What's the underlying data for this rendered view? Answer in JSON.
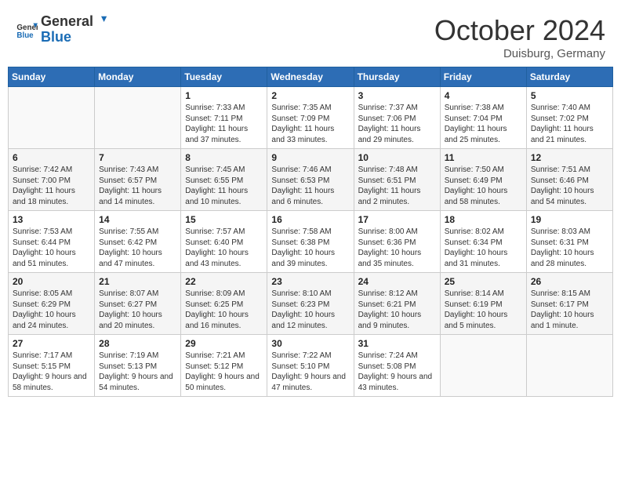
{
  "header": {
    "logo_general": "General",
    "logo_blue": "Blue",
    "month_title": "October 2024",
    "location": "Duisburg, Germany"
  },
  "days_of_week": [
    "Sunday",
    "Monday",
    "Tuesday",
    "Wednesday",
    "Thursday",
    "Friday",
    "Saturday"
  ],
  "weeks": [
    [
      {
        "day": "",
        "info": ""
      },
      {
        "day": "",
        "info": ""
      },
      {
        "day": "1",
        "info": "Sunrise: 7:33 AM\nSunset: 7:11 PM\nDaylight: 11 hours and 37 minutes."
      },
      {
        "day": "2",
        "info": "Sunrise: 7:35 AM\nSunset: 7:09 PM\nDaylight: 11 hours and 33 minutes."
      },
      {
        "day": "3",
        "info": "Sunrise: 7:37 AM\nSunset: 7:06 PM\nDaylight: 11 hours and 29 minutes."
      },
      {
        "day": "4",
        "info": "Sunrise: 7:38 AM\nSunset: 7:04 PM\nDaylight: 11 hours and 25 minutes."
      },
      {
        "day": "5",
        "info": "Sunrise: 7:40 AM\nSunset: 7:02 PM\nDaylight: 11 hours and 21 minutes."
      }
    ],
    [
      {
        "day": "6",
        "info": "Sunrise: 7:42 AM\nSunset: 7:00 PM\nDaylight: 11 hours and 18 minutes."
      },
      {
        "day": "7",
        "info": "Sunrise: 7:43 AM\nSunset: 6:57 PM\nDaylight: 11 hours and 14 minutes."
      },
      {
        "day": "8",
        "info": "Sunrise: 7:45 AM\nSunset: 6:55 PM\nDaylight: 11 hours and 10 minutes."
      },
      {
        "day": "9",
        "info": "Sunrise: 7:46 AM\nSunset: 6:53 PM\nDaylight: 11 hours and 6 minutes."
      },
      {
        "day": "10",
        "info": "Sunrise: 7:48 AM\nSunset: 6:51 PM\nDaylight: 11 hours and 2 minutes."
      },
      {
        "day": "11",
        "info": "Sunrise: 7:50 AM\nSunset: 6:49 PM\nDaylight: 10 hours and 58 minutes."
      },
      {
        "day": "12",
        "info": "Sunrise: 7:51 AM\nSunset: 6:46 PM\nDaylight: 10 hours and 54 minutes."
      }
    ],
    [
      {
        "day": "13",
        "info": "Sunrise: 7:53 AM\nSunset: 6:44 PM\nDaylight: 10 hours and 51 minutes."
      },
      {
        "day": "14",
        "info": "Sunrise: 7:55 AM\nSunset: 6:42 PM\nDaylight: 10 hours and 47 minutes."
      },
      {
        "day": "15",
        "info": "Sunrise: 7:57 AM\nSunset: 6:40 PM\nDaylight: 10 hours and 43 minutes."
      },
      {
        "day": "16",
        "info": "Sunrise: 7:58 AM\nSunset: 6:38 PM\nDaylight: 10 hours and 39 minutes."
      },
      {
        "day": "17",
        "info": "Sunrise: 8:00 AM\nSunset: 6:36 PM\nDaylight: 10 hours and 35 minutes."
      },
      {
        "day": "18",
        "info": "Sunrise: 8:02 AM\nSunset: 6:34 PM\nDaylight: 10 hours and 31 minutes."
      },
      {
        "day": "19",
        "info": "Sunrise: 8:03 AM\nSunset: 6:31 PM\nDaylight: 10 hours and 28 minutes."
      }
    ],
    [
      {
        "day": "20",
        "info": "Sunrise: 8:05 AM\nSunset: 6:29 PM\nDaylight: 10 hours and 24 minutes."
      },
      {
        "day": "21",
        "info": "Sunrise: 8:07 AM\nSunset: 6:27 PM\nDaylight: 10 hours and 20 minutes."
      },
      {
        "day": "22",
        "info": "Sunrise: 8:09 AM\nSunset: 6:25 PM\nDaylight: 10 hours and 16 minutes."
      },
      {
        "day": "23",
        "info": "Sunrise: 8:10 AM\nSunset: 6:23 PM\nDaylight: 10 hours and 12 minutes."
      },
      {
        "day": "24",
        "info": "Sunrise: 8:12 AM\nSunset: 6:21 PM\nDaylight: 10 hours and 9 minutes."
      },
      {
        "day": "25",
        "info": "Sunrise: 8:14 AM\nSunset: 6:19 PM\nDaylight: 10 hours and 5 minutes."
      },
      {
        "day": "26",
        "info": "Sunrise: 8:15 AM\nSunset: 6:17 PM\nDaylight: 10 hours and 1 minute."
      }
    ],
    [
      {
        "day": "27",
        "info": "Sunrise: 7:17 AM\nSunset: 5:15 PM\nDaylight: 9 hours and 58 minutes."
      },
      {
        "day": "28",
        "info": "Sunrise: 7:19 AM\nSunset: 5:13 PM\nDaylight: 9 hours and 54 minutes."
      },
      {
        "day": "29",
        "info": "Sunrise: 7:21 AM\nSunset: 5:12 PM\nDaylight: 9 hours and 50 minutes."
      },
      {
        "day": "30",
        "info": "Sunrise: 7:22 AM\nSunset: 5:10 PM\nDaylight: 9 hours and 47 minutes."
      },
      {
        "day": "31",
        "info": "Sunrise: 7:24 AM\nSunset: 5:08 PM\nDaylight: 9 hours and 43 minutes."
      },
      {
        "day": "",
        "info": ""
      },
      {
        "day": "",
        "info": ""
      }
    ]
  ]
}
